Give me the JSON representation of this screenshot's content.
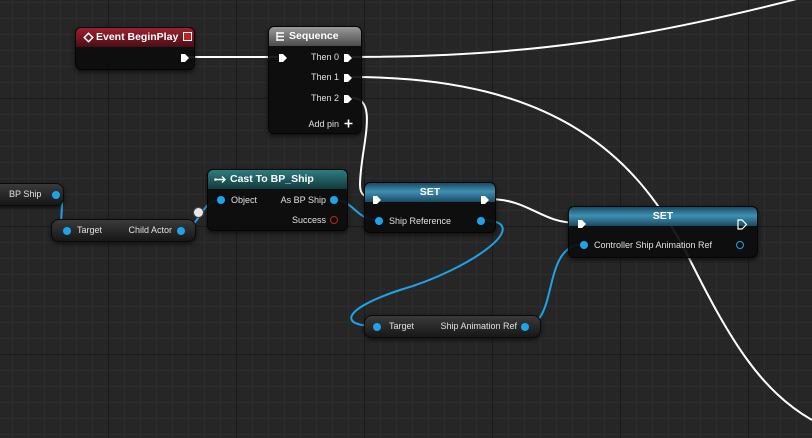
{
  "nodes": {
    "event_begin_play": {
      "title": "Event BeginPlay"
    },
    "sequence": {
      "title": "Sequence",
      "then0": "Then 0",
      "then1": "Then 1",
      "then2": "Then 2",
      "add_pin": "Add pin"
    },
    "bp_ship_var": {
      "label": "BP Ship"
    },
    "get_child_actor": {
      "target": "Target",
      "child_actor": "Child Actor"
    },
    "cast": {
      "title": "Cast To BP_Ship",
      "object": "Object",
      "as_bp_ship": "As BP Ship",
      "success": "Success"
    },
    "set_ship_reference": {
      "title": "SET",
      "ship_reference": "Ship Reference"
    },
    "set_controller": {
      "title": "SET",
      "controller_ref": "Controller Ship Animation Ref"
    },
    "get_ship_anim_ref": {
      "target": "Target",
      "ship_animation_ref": "Ship Animation Ref"
    }
  },
  "colors": {
    "exec_wire": "#ffffff",
    "object_wire": "#1fa3e8",
    "event_header": "#9d2030",
    "cast_header": "#2d7d80",
    "set_header": "#3f90b3",
    "success_pin": "#c42020"
  },
  "icons": [
    "event-diamond-icon",
    "delegate-square-icon",
    "sequence-icon",
    "cast-arrow-icon",
    "plus-icon"
  ]
}
